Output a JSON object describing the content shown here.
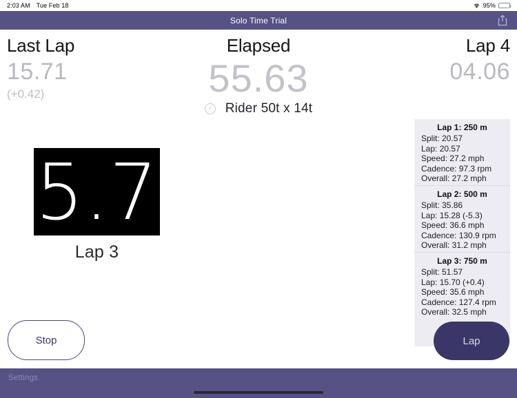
{
  "status_bar": {
    "time": "2:03 AM",
    "date": "Tue Feb 18",
    "wifi_icon": "wifi-icon",
    "battery_percent": "95%",
    "battery_level": 95,
    "battery_color": "#3ac05a"
  },
  "nav": {
    "title": "Solo Time Trial",
    "share_icon": "share-icon",
    "bar_color": "#565285"
  },
  "stats": {
    "last_lap": {
      "label": "Last Lap",
      "value": "15.71",
      "delta": "(+0.42)"
    },
    "elapsed": {
      "label": "Elapsed",
      "value": "55.63",
      "gear_info_icon": "info-circle-icon",
      "gear_text": "Rider 50t x 14t"
    },
    "current_lap": {
      "label": "Lap 4",
      "value": "04.06"
    }
  },
  "speed_display": {
    "value": "5.7",
    "caption": "Lap 3",
    "background": "#000000",
    "text_color": "#ffffff"
  },
  "lap_list": {
    "laps": [
      {
        "title": "Lap 1: 250 m",
        "split": "Split: 20.57",
        "lap": "Lap: 20.57",
        "speed": "Speed: 27.2 mph",
        "cadence": "Cadence: 97.3 rpm",
        "overall": "Overall: 27.2 mph"
      },
      {
        "title": "Lap 2: 500 m",
        "split": "Split: 35.86",
        "lap": "Lap: 15.28 (-5.3)",
        "speed": "Speed: 36.6 mph",
        "cadence": "Cadence: 130.9 rpm",
        "overall": "Overall: 31.2 mph"
      },
      {
        "title": "Lap 3: 750 m",
        "split": "Split: 51.57",
        "lap": "Lap: 15.70 (+0.4)",
        "speed": "Speed: 35.6 mph",
        "cadence": "Cadence: 127.4 rpm",
        "overall": "Overall: 32.5 mph"
      }
    ],
    "background": "#edecf3"
  },
  "buttons": {
    "stop": "Stop",
    "lap": "Lap",
    "lap_button_color": "#3a3668"
  },
  "toolbar": {
    "settings": "Settings"
  }
}
